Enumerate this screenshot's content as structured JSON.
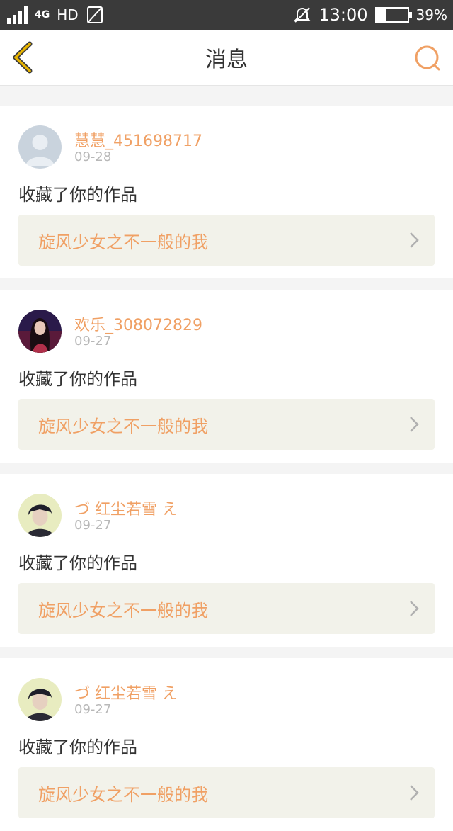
{
  "status_bar": {
    "network": "4G",
    "hd": "HD",
    "time": "13:00",
    "battery": "39%"
  },
  "header": {
    "title": "消息"
  },
  "messages": [
    {
      "username": "慧慧_451698717",
      "date": "09-28",
      "action": "收藏了你的作品",
      "work": "旋风少女之不一般的我",
      "avatar": "default-avatar"
    },
    {
      "username": "欢乐_308072829",
      "date": "09-27",
      "action": "收藏了你的作品",
      "work": "旋风少女之不一般的我",
      "avatar": "photo-avatar"
    },
    {
      "username": "づ 红尘若雪 え",
      "date": "09-27",
      "action": "收藏了你的作品",
      "work": "旋风少女之不一般的我",
      "avatar": "photo-avatar"
    },
    {
      "username": "づ 红尘若雪 え",
      "date": "09-27",
      "action": "收藏了你的作品",
      "work": "旋风少女之不一般的我",
      "avatar": "photo-avatar"
    }
  ],
  "colors": {
    "accent": "#f0a064",
    "back_arrow": "#e8b400",
    "work_bg": "#f2f2ea"
  }
}
